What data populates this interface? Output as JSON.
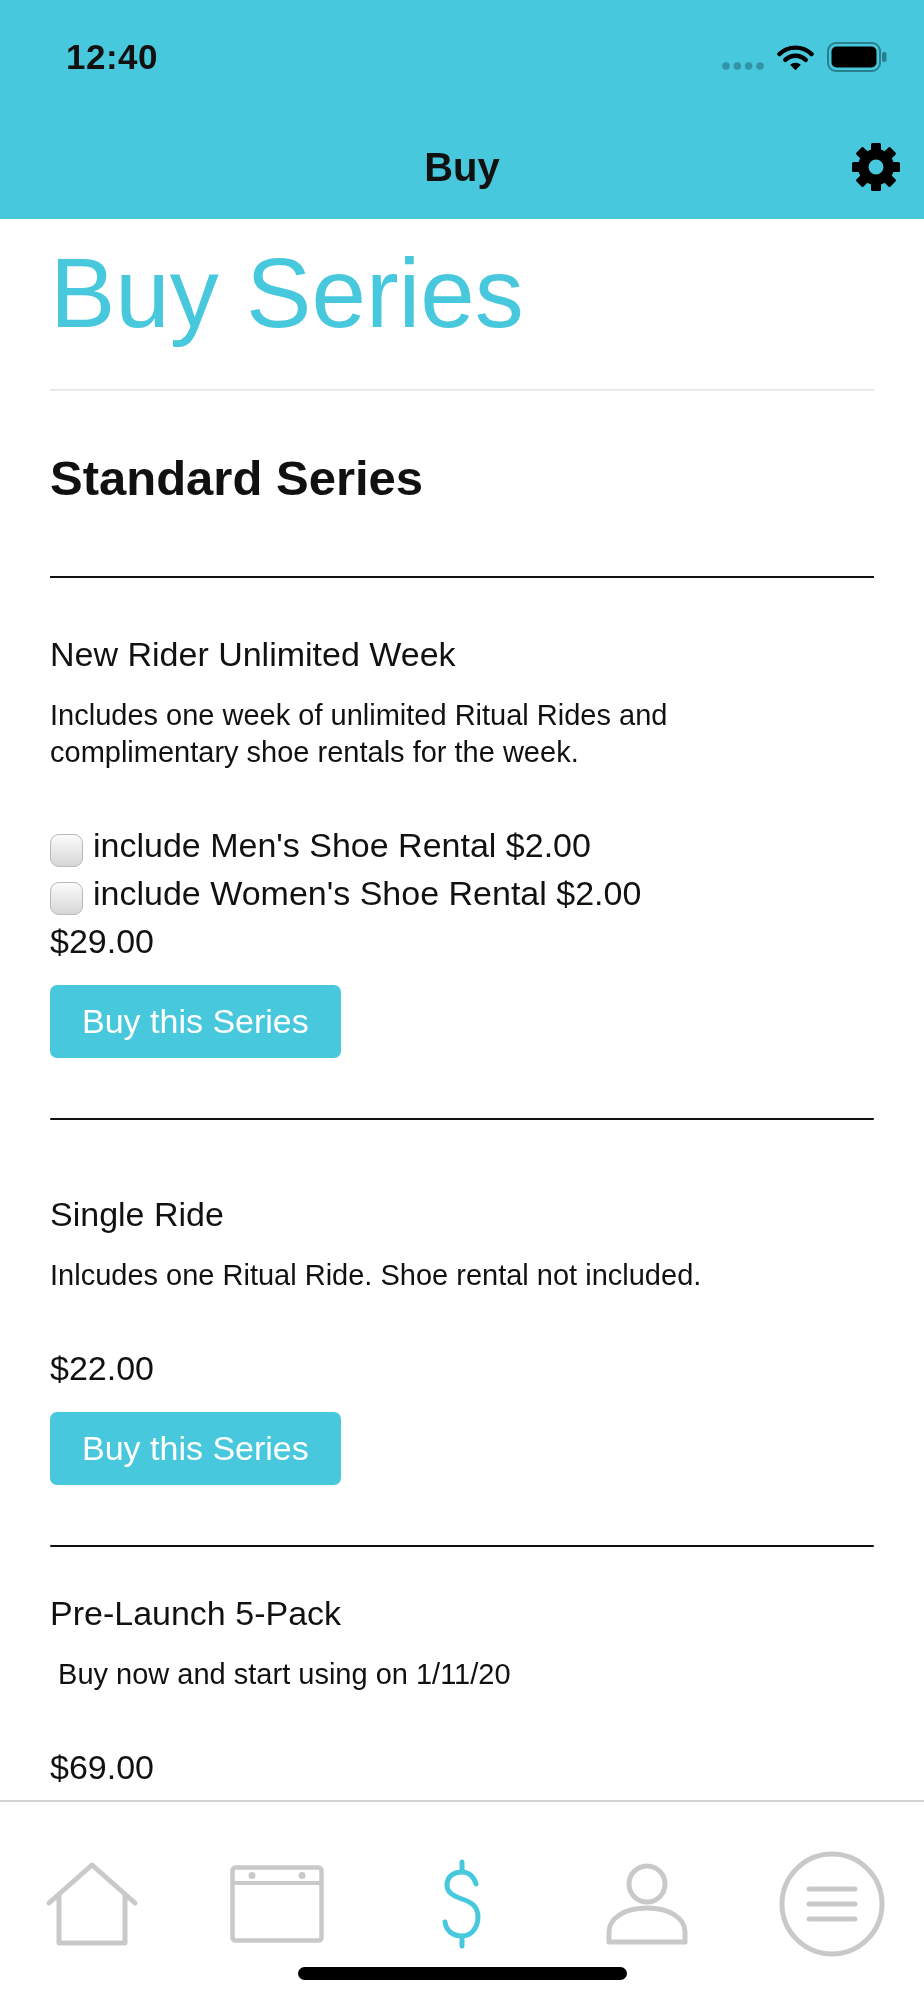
{
  "status_bar": {
    "time": "12:40"
  },
  "nav_bar": {
    "title": "Buy"
  },
  "page": {
    "title": "Buy Series",
    "section_title": "Standard Series"
  },
  "series": [
    {
      "name": "New Rider Unlimited Week",
      "description": "Includes one week of unlimited Ritual Rides and complimentary shoe rentals for the week.",
      "options": [
        {
          "label": "include Men's Shoe Rental $2.00",
          "checked": false
        },
        {
          "label": "include Women's Shoe Rental $2.00",
          "checked": false
        }
      ],
      "price": "$29.00",
      "button": "Buy this Series"
    },
    {
      "name": "Single Ride",
      "description": "Inlcudes one Ritual Ride. Shoe rental not included.",
      "price": "$22.00",
      "button": "Buy this Series"
    },
    {
      "name": "Pre-Launch 5-Pack",
      "description": " Buy now and start using on 1/11/20",
      "price": "$69.00"
    }
  ],
  "tab_bar": {
    "tabs": [
      {
        "selected": false
      },
      {
        "selected": false
      },
      {
        "selected": true
      },
      {
        "selected": false
      },
      {
        "selected": false
      }
    ]
  }
}
